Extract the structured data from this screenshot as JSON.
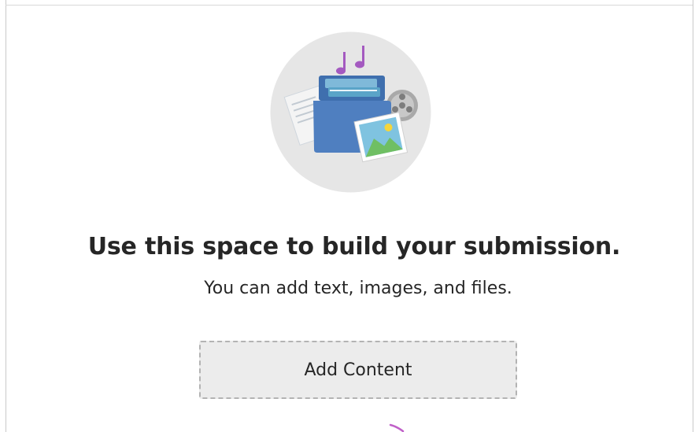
{
  "empty_state": {
    "illustration_icon": "media-folder-illustration",
    "headline": "Use this space to build your submission.",
    "subtext": "You can add text, images, and files.",
    "add_content_label": "Add Content"
  },
  "colors": {
    "circle_bg": "#e6e6e6",
    "folder_blue": "#4f7fc0",
    "music_note": "#a45ac0",
    "text": "#262626",
    "button_bg": "#ececec",
    "button_border": "#b3b3b3"
  }
}
